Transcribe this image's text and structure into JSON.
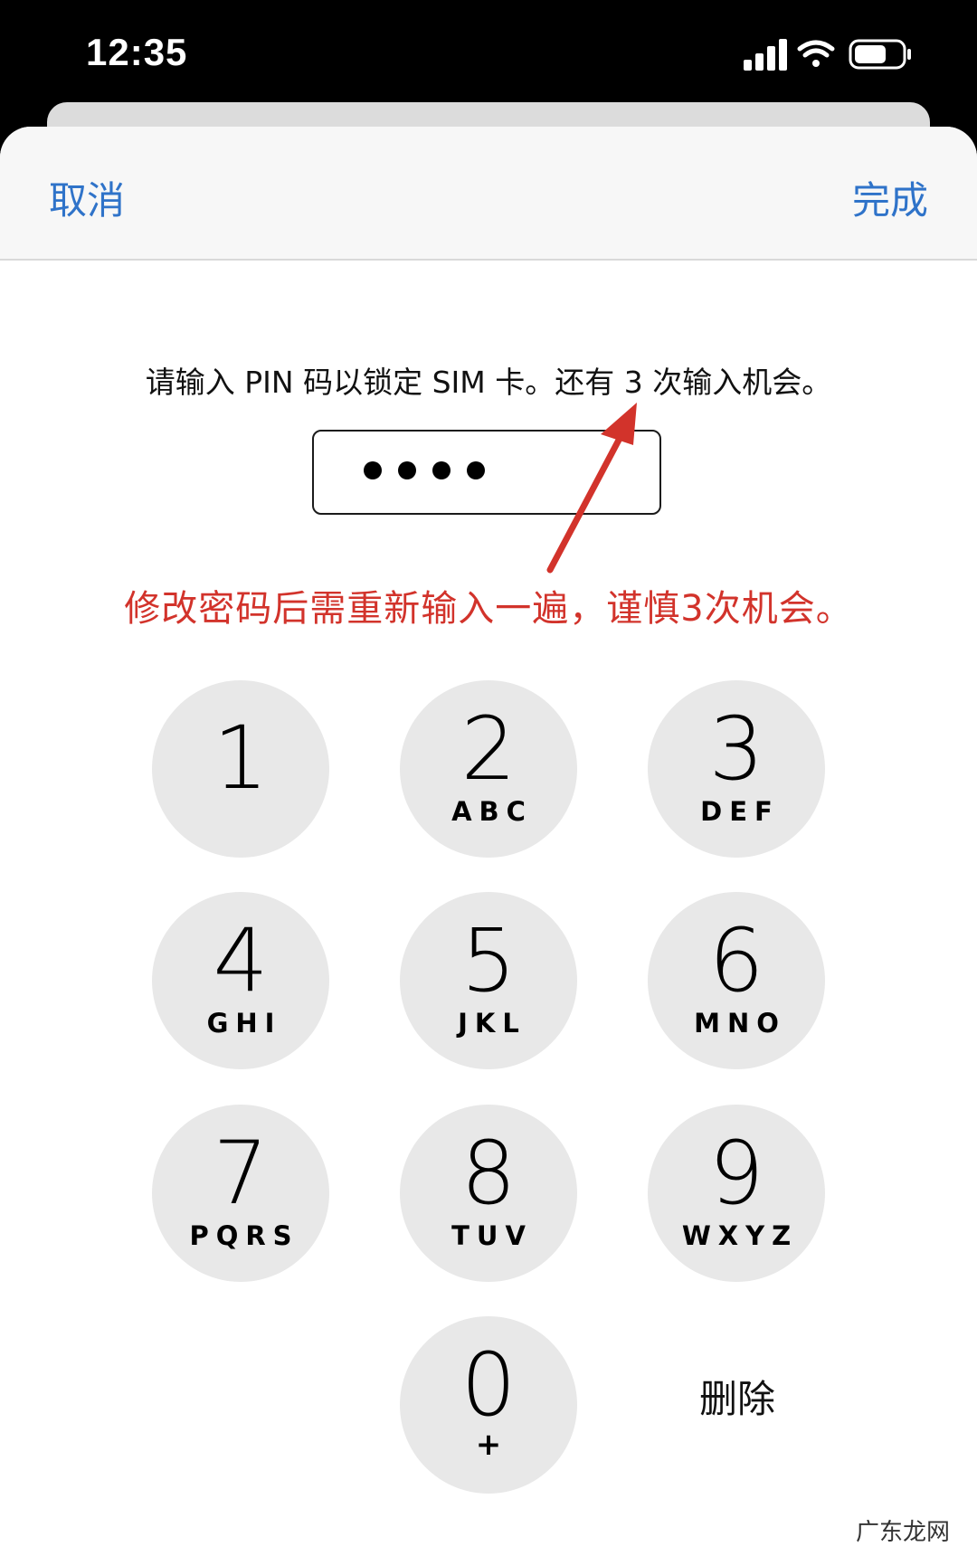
{
  "status_bar": {
    "time": "12:35",
    "icons": [
      "signal-icon",
      "wifi-icon",
      "battery-icon"
    ]
  },
  "nav": {
    "cancel_label": "取消",
    "done_label": "完成"
  },
  "prompt": "请输入 PIN 码以锁定 SIM 卡。还有 3 次输入机会。",
  "pin_field": {
    "entered_digits_count": 4
  },
  "annotation": "修改密码后需重新输入一遍，谨慎3次机会。",
  "keypad": [
    {
      "digit": "1",
      "letters": ""
    },
    {
      "digit": "2",
      "letters": "ABC"
    },
    {
      "digit": "3",
      "letters": "DEF"
    },
    {
      "digit": "4",
      "letters": "GHI"
    },
    {
      "digit": "5",
      "letters": "JKL"
    },
    {
      "digit": "6",
      "letters": "MNO"
    },
    {
      "digit": "7",
      "letters": "PQRS"
    },
    {
      "digit": "8",
      "letters": "TUV"
    },
    {
      "digit": "9",
      "letters": "WXYZ"
    },
    {
      "digit": "0",
      "letters": "+"
    }
  ],
  "delete_label": "删除",
  "watermark": "广东龙网",
  "colors": {
    "accent": "#2f73c9",
    "annotation": "#d2332b",
    "key_bg": "#e8e8e8"
  }
}
